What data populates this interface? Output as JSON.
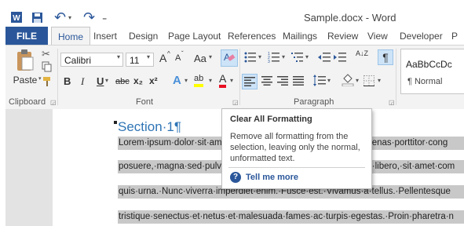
{
  "window": {
    "title": "Sample.docx - Word",
    "qat_undo": "↶",
    "qat_redo": "↷",
    "qat_custom": "₌"
  },
  "tabs": [
    "FILE",
    "Home",
    "Insert",
    "Design",
    "Page Layout",
    "References",
    "Mailings",
    "Review",
    "View",
    "Developer",
    "P"
  ],
  "ribbon": {
    "clipboard": {
      "paste_label": "Paste",
      "group_label": "Clipboard"
    },
    "font": {
      "font_name": "Calibri",
      "font_size": "11",
      "group_label": "Font",
      "grow": "A",
      "shrink": "A",
      "change_case": "Aa",
      "bold": "B",
      "italic": "I",
      "underline": "U",
      "strike": "abc",
      "subscript": "x₂",
      "superscript": "x²",
      "effects": "A",
      "highlight": "ab",
      "font_color": "A"
    },
    "paragraph": {
      "group_label": "Paragraph",
      "sort": "A↓Z",
      "pilcrow": "¶"
    },
    "styles": {
      "preview": "AaBbCcDc",
      "name": "¶ Normal"
    }
  },
  "document": {
    "heading": "Section·1¶",
    "lines": [
      "Lorem·ipsum·dolor·sit·amet,·consectetuer·adipiscing·elit.·Maecenas·porttitor·cong",
      "posuere,·magna·sed·pulvinar·ultricies,·purus·lectus·malesuada·libero,·sit·amet·com",
      "quis·urna.·Nunc·viverra·imperdiet·enim.·Fusce·est.·Vivamus·a·tellus.·Pellentesque",
      "tristique·senectus·et·netus·et·malesuada·fames·ac·turpis·egestas.·Proin·pharetra·n"
    ]
  },
  "tooltip": {
    "title": "Clear All Formatting",
    "description": "Remove all formatting from the selection, leaving only the normal, unformatted text.",
    "help_icon": "?",
    "link": "Tell me more"
  },
  "colors": {
    "accent": "#2b579a",
    "heading": "#2e74b5",
    "selection": "#c8c8c8",
    "highlight_yellow": "#ffff00",
    "font_red": "#e81123"
  }
}
